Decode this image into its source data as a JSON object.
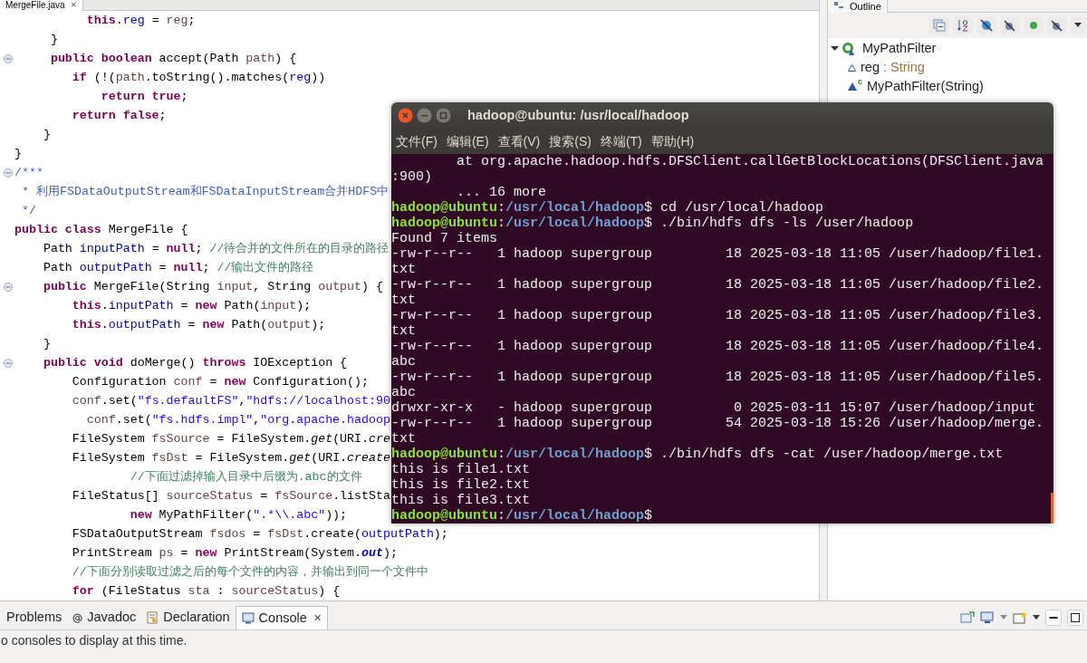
{
  "editor": {
    "tab": {
      "label": "MergeFile.java",
      "close": "✕"
    },
    "lines": [
      {
        "segments": [
          {
            "kind": "kw",
            "text": "          this"
          },
          {
            "kind": "txt",
            "text": "."
          },
          {
            "kind": "field",
            "text": "reg"
          },
          {
            "kind": "txt",
            "text": " = "
          },
          {
            "kind": "var",
            "text": "reg"
          },
          {
            "kind": "txt",
            "text": ";"
          }
        ]
      },
      {
        "segments": [
          {
            "kind": "txt",
            "text": "     }"
          }
        ]
      },
      {
        "collapsible": true,
        "segments": [
          {
            "kind": "kw",
            "text": "     public boolean"
          },
          {
            "kind": "txt",
            "text": " accept(Path "
          },
          {
            "kind": "var",
            "text": "path"
          },
          {
            "kind": "txt",
            "text": ") {"
          }
        ]
      },
      {
        "segments": [
          {
            "kind": "kw",
            "text": "        if"
          },
          {
            "kind": "txt",
            "text": " (!("
          },
          {
            "kind": "var",
            "text": "path"
          },
          {
            "kind": "txt",
            "text": ".toString().matches("
          },
          {
            "kind": "field",
            "text": "reg"
          },
          {
            "kind": "txt",
            "text": "))"
          }
        ]
      },
      {
        "segments": [
          {
            "kind": "kw",
            "text": "            return true"
          },
          {
            "kind": "txt",
            "text": ";"
          }
        ]
      },
      {
        "segments": [
          {
            "kind": "kw",
            "text": "        return false"
          },
          {
            "kind": "txt",
            "text": ";"
          }
        ]
      },
      {
        "segments": [
          {
            "kind": "txt",
            "text": "    }"
          }
        ]
      },
      {
        "segments": [
          {
            "kind": "txt",
            "text": "}"
          }
        ]
      },
      {
        "collapsible": true,
        "segments": [
          {
            "kind": "doc",
            "text": "/***"
          }
        ]
      },
      {
        "segments": [
          {
            "kind": "doc",
            "text": " * 利用FSDataOutputStream和FSDataInputStream合并HDFS中"
          }
        ]
      },
      {
        "segments": [
          {
            "kind": "doc",
            "text": " */"
          }
        ]
      },
      {
        "segments": [
          {
            "kind": "kw",
            "text": "public class"
          },
          {
            "kind": "txt",
            "text": " MergeFile {"
          }
        ]
      },
      {
        "segments": [
          {
            "kind": "txt",
            "text": "    Path "
          },
          {
            "kind": "field",
            "text": "inputPath"
          },
          {
            "kind": "txt",
            "text": " = "
          },
          {
            "kind": "kw",
            "text": "null"
          },
          {
            "kind": "txt",
            "text": ";"
          },
          {
            "kind": "cmt",
            "text": " //待合并的文件所在的目录的路径"
          }
        ]
      },
      {
        "segments": [
          {
            "kind": "txt",
            "text": "    Path "
          },
          {
            "kind": "field",
            "text": "outputPath"
          },
          {
            "kind": "txt",
            "text": " = "
          },
          {
            "kind": "kw",
            "text": "null"
          },
          {
            "kind": "txt",
            "text": ";"
          },
          {
            "kind": "cmt",
            "text": " //输出文件的路径"
          }
        ]
      },
      {
        "collapsible": true,
        "segments": [
          {
            "kind": "kw",
            "text": "    public"
          },
          {
            "kind": "txt",
            "text": " MergeFile(String "
          },
          {
            "kind": "var",
            "text": "input"
          },
          {
            "kind": "txt",
            "text": ", String "
          },
          {
            "kind": "var",
            "text": "output"
          },
          {
            "kind": "txt",
            "text": ") {"
          }
        ]
      },
      {
        "segments": [
          {
            "kind": "kw",
            "text": "        this"
          },
          {
            "kind": "txt",
            "text": "."
          },
          {
            "kind": "field",
            "text": "inputPath"
          },
          {
            "kind": "txt",
            "text": " = "
          },
          {
            "kind": "kw",
            "text": "new"
          },
          {
            "kind": "txt",
            "text": " Path("
          },
          {
            "kind": "var",
            "text": "input"
          },
          {
            "kind": "txt",
            "text": ");"
          }
        ]
      },
      {
        "segments": [
          {
            "kind": "kw",
            "text": "        this"
          },
          {
            "kind": "txt",
            "text": "."
          },
          {
            "kind": "field",
            "text": "outputPath"
          },
          {
            "kind": "txt",
            "text": " = "
          },
          {
            "kind": "kw",
            "text": "new"
          },
          {
            "kind": "txt",
            "text": " Path("
          },
          {
            "kind": "var",
            "text": "output"
          },
          {
            "kind": "txt",
            "text": ");"
          }
        ]
      },
      {
        "segments": [
          {
            "kind": "txt",
            "text": "    }"
          }
        ]
      },
      {
        "collapsible": true,
        "segments": [
          {
            "kind": "kw",
            "text": "    public void"
          },
          {
            "kind": "txt",
            "text": " doMerge() "
          },
          {
            "kind": "kw",
            "text": "throws"
          },
          {
            "kind": "txt",
            "text": " IOException {"
          }
        ]
      },
      {
        "segments": [
          {
            "kind": "txt",
            "text": "        Configuration "
          },
          {
            "kind": "var",
            "text": "conf"
          },
          {
            "kind": "txt",
            "text": " = "
          },
          {
            "kind": "kw",
            "text": "new"
          },
          {
            "kind": "txt",
            "text": " Configuration();"
          }
        ]
      },
      {
        "segments": [
          {
            "kind": "var",
            "text": "        conf"
          },
          {
            "kind": "txt",
            "text": ".set("
          },
          {
            "kind": "str",
            "text": "\"fs.defaultFS\""
          },
          {
            "kind": "txt",
            "text": ","
          },
          {
            "kind": "str",
            "text": "\"hdfs://localhost:90"
          }
        ]
      },
      {
        "segments": [
          {
            "kind": "var",
            "text": "          conf"
          },
          {
            "kind": "txt",
            "text": ".set("
          },
          {
            "kind": "str",
            "text": "\"fs.hdfs.impl\""
          },
          {
            "kind": "txt",
            "text": ","
          },
          {
            "kind": "str",
            "text": "\"org.apache.hadoop"
          }
        ]
      },
      {
        "segments": [
          {
            "kind": "txt",
            "text": "        FileSystem "
          },
          {
            "kind": "var",
            "text": "fsSource"
          },
          {
            "kind": "txt",
            "text": " = FileSystem."
          },
          {
            "kind": "ital",
            "text": "get"
          },
          {
            "kind": "txt",
            "text": "(URI."
          },
          {
            "kind": "ital",
            "text": "cre"
          }
        ]
      },
      {
        "segments": [
          {
            "kind": "txt",
            "text": "        FileSystem "
          },
          {
            "kind": "var",
            "text": "fsDst"
          },
          {
            "kind": "txt",
            "text": " = FileSystem."
          },
          {
            "kind": "ital",
            "text": "get"
          },
          {
            "kind": "txt",
            "text": "(URI."
          },
          {
            "kind": "ital",
            "text": "create"
          }
        ]
      },
      {
        "segments": [
          {
            "kind": "cmt",
            "text": "                //下面过滤掉输入目录中后缀为.abc的文件"
          }
        ]
      },
      {
        "segments": [
          {
            "kind": "txt",
            "text": "        FileStatus[] "
          },
          {
            "kind": "var",
            "text": "sourceStatus"
          },
          {
            "kind": "txt",
            "text": " = "
          },
          {
            "kind": "var",
            "text": "fsSource"
          },
          {
            "kind": "txt",
            "text": ".listSta"
          }
        ]
      },
      {
        "segments": [
          {
            "kind": "kw",
            "text": "                new"
          },
          {
            "kind": "txt",
            "text": " MyPathFilter("
          },
          {
            "kind": "str",
            "text": "\".*\\\\.abc\""
          },
          {
            "kind": "txt",
            "text": "));"
          }
        ]
      },
      {
        "segments": [
          {
            "kind": "txt",
            "text": "        FSDataOutputStream "
          },
          {
            "kind": "var",
            "text": "fsdos"
          },
          {
            "kind": "txt",
            "text": " = "
          },
          {
            "kind": "var",
            "text": "fsDst"
          },
          {
            "kind": "txt",
            "text": ".create("
          },
          {
            "kind": "field",
            "text": "outputPath"
          },
          {
            "kind": "txt",
            "text": ");"
          }
        ]
      },
      {
        "segments": [
          {
            "kind": "txt",
            "text": "        PrintStream "
          },
          {
            "kind": "var",
            "text": "ps"
          },
          {
            "kind": "txt",
            "text": " = "
          },
          {
            "kind": "kw",
            "text": "new"
          },
          {
            "kind": "txt",
            "text": " PrintStream(System."
          },
          {
            "kind": "fieldital",
            "text": "out"
          },
          {
            "kind": "txt",
            "text": ");"
          }
        ]
      },
      {
        "segments": [
          {
            "kind": "cmt",
            "text": "        //下面分别读取过滤之后的每个文件的内容，并输出到同一个文件中"
          }
        ]
      },
      {
        "segments": [
          {
            "kind": "kw",
            "text": "        for"
          },
          {
            "kind": "txt",
            "text": " (FileStatus "
          },
          {
            "kind": "var",
            "text": "sta"
          },
          {
            "kind": "txt",
            "text": " : "
          },
          {
            "kind": "var",
            "text": "sourceStatus"
          },
          {
            "kind": "txt",
            "text": ") {"
          }
        ]
      }
    ]
  },
  "outline": {
    "tab": "Outline",
    "tree": [
      {
        "label": "MyPathFilter",
        "expanded": true,
        "children": [
          {
            "label": "reg",
            "type": " : String",
            "kind": "field"
          },
          {
            "label": "MyPathFilter(String)",
            "kind": "constructor",
            "badge": "c"
          }
        ]
      }
    ]
  },
  "bottom_panel": {
    "tabs": [
      {
        "label": "Problems",
        "selected": false
      },
      {
        "label": "Javadoc",
        "selected": false
      },
      {
        "label": "Declaration",
        "selected": false
      },
      {
        "label": "Console",
        "selected": true,
        "close": "✕"
      }
    ],
    "message": "o consoles to display at this time."
  },
  "terminal": {
    "title": "hadoop@ubuntu: /usr/local/hadoop",
    "menu": [
      "文件(F)",
      "编辑(E)",
      "查看(V)",
      "搜索(S)",
      "终端(T)",
      "帮助(H)"
    ],
    "lines": [
      {
        "kind": "text",
        "text": "        at org.apache.hadoop.hdfs.DFSClient.callGetBlockLocations(DFSClient.java"
      },
      {
        "kind": "text",
        "text": ":900)"
      },
      {
        "kind": "text",
        "text": "        ... 16 more"
      },
      {
        "kind": "prompt",
        "user": "hadoop@ubuntu",
        "separator": ":",
        "path": "/usr/local/hadoop",
        "command": "$ cd /usr/local/hadoop"
      },
      {
        "kind": "prompt",
        "user": "hadoop@ubuntu",
        "separator": ":",
        "path": "/usr/local/hadoop",
        "command": "$ ./bin/hdfs dfs -ls /user/hadoop"
      },
      {
        "kind": "text",
        "text": "Found 7 items"
      },
      {
        "kind": "text",
        "text": "-rw-r--r--   1 hadoop supergroup         18 2025-03-18 11:05 /user/hadoop/file1."
      },
      {
        "kind": "text",
        "text": "txt"
      },
      {
        "kind": "text",
        "text": "-rw-r--r--   1 hadoop supergroup         18 2025-03-18 11:05 /user/hadoop/file2."
      },
      {
        "kind": "text",
        "text": "txt"
      },
      {
        "kind": "text",
        "text": "-rw-r--r--   1 hadoop supergroup         18 2025-03-18 11:05 /user/hadoop/file3."
      },
      {
        "kind": "text",
        "text": "txt"
      },
      {
        "kind": "text",
        "text": "-rw-r--r--   1 hadoop supergroup         18 2025-03-18 11:05 /user/hadoop/file4."
      },
      {
        "kind": "text",
        "text": "abc"
      },
      {
        "kind": "text",
        "text": "-rw-r--r--   1 hadoop supergroup         18 2025-03-18 11:05 /user/hadoop/file5."
      },
      {
        "kind": "text",
        "text": "abc"
      },
      {
        "kind": "text",
        "text": "drwxr-xr-x   - hadoop supergroup          0 2025-03-11 15:07 /user/hadoop/input"
      },
      {
        "kind": "text",
        "text": "-rw-r--r--   1 hadoop supergroup         54 2025-03-18 15:26 /user/hadoop/merge."
      },
      {
        "kind": "text",
        "text": "txt"
      },
      {
        "kind": "prompt",
        "user": "hadoop@ubuntu",
        "separator": ":",
        "path": "/usr/local/hadoop",
        "command": "$ ./bin/hdfs dfs -cat /user/hadoop/merge.txt"
      },
      {
        "kind": "text",
        "text": "this is file1.txt"
      },
      {
        "kind": "text",
        "text": "this is file2.txt"
      },
      {
        "kind": "text",
        "text": "this is file3.txt"
      },
      {
        "kind": "prompt",
        "user": "hadoop@ubuntu",
        "separator": ":",
        "path": "/usr/local/hadoop",
        "command": "$"
      }
    ]
  }
}
